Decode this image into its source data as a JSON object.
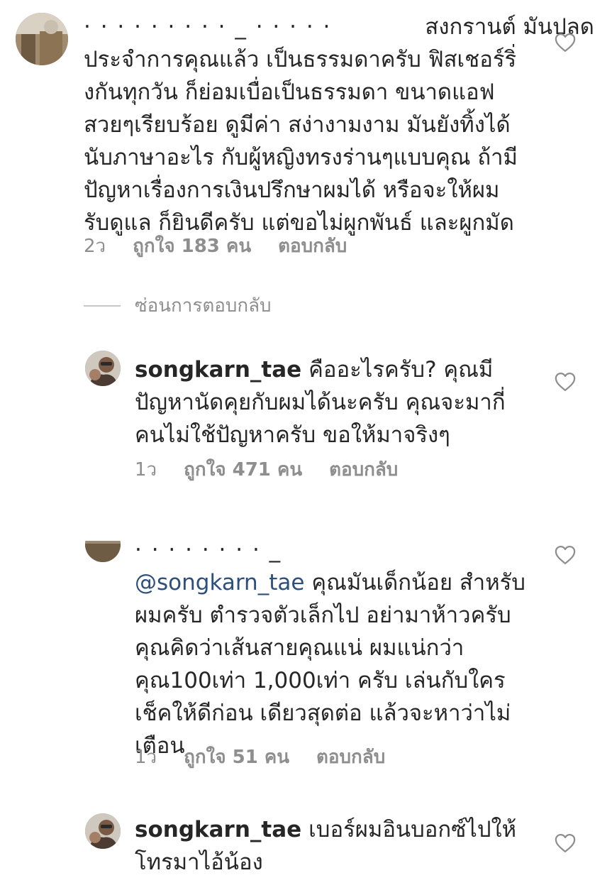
{
  "comments": [
    {
      "username": "· · · · · · · · · _ · · · · ·",
      "lines": [
        "สงกรานต์ มันปลด",
        "ประจำการคุณแล้ว เป็นธรรมดาครับ ฟิสเชอร์ริ่",
        "งกันทุกวัน ก็ย่อมเบื่อเป็นธรรมดา ขนาดแอฟ",
        "สวยๆเรียบร้อย ดูมีค่า สง่างามงาม มันยังทิ้งได้",
        "นับภาษาอะไร กับผู้หญิงทรงร่านๆแบบคุณ ถ้ามี",
        "ปัญหาเรื่องการเงินปรึกษาผมได้ หรือจะให้ผม",
        "รับดูแล ก็ยินดีครับ แต่ขอไม่ผูกพันธ์ และผูกมัด"
      ],
      "time": "2ว",
      "likes": "ถูกใจ 183 คน",
      "reply": "ตอบกลับ"
    },
    {
      "username": "songkarn_tae",
      "lines": [
        "คืออะไรครับ? คุณมี",
        "ปัญหานัดคุยกับผมได้นะครับ คุณจะมากี่",
        "คนไม่ใช้ปัญหาครับ ขอให้มาจริงๆ"
      ],
      "time": "1ว",
      "likes": "ถูกใจ 471 คน",
      "reply": "ตอบกลับ"
    },
    {
      "username": "· · · · · · · · _",
      "mention": "@songkarn_tae",
      "lines": [
        "คุณมันเด็กน้อย สำหรับ",
        "ผมครับ ตำรวจตัวเล็กไป อย่ามาห้าวครับ",
        "คุณคิดว่าเส้นสายคุณแน่ ผมแน่กว่า",
        "คุณ100เท่า 1,000เท่า ครับ เล่นกับใคร",
        "เช็คให้ดีก่อน เดียวสุดต่อ แล้วจะหาว่าไม่",
        "เตือน"
      ],
      "time": "1ว",
      "likes": "ถูกใจ 51 คน",
      "reply": "ตอบกลับ"
    },
    {
      "username": "songkarn_tae",
      "lines": [
        "เบอร์ผมอินบอกซ์ไปให้",
        "โทรมาไอ้น้อง"
      ]
    }
  ],
  "hide_replies": "ซ่อนการตอบกลับ",
  "colors": {
    "text": "#262626",
    "secondary": "#8e8e8e",
    "mention": "#2d4f7b",
    "divider": "#c7c7c7"
  },
  "icons": {
    "like": "heart-outline-icon"
  }
}
